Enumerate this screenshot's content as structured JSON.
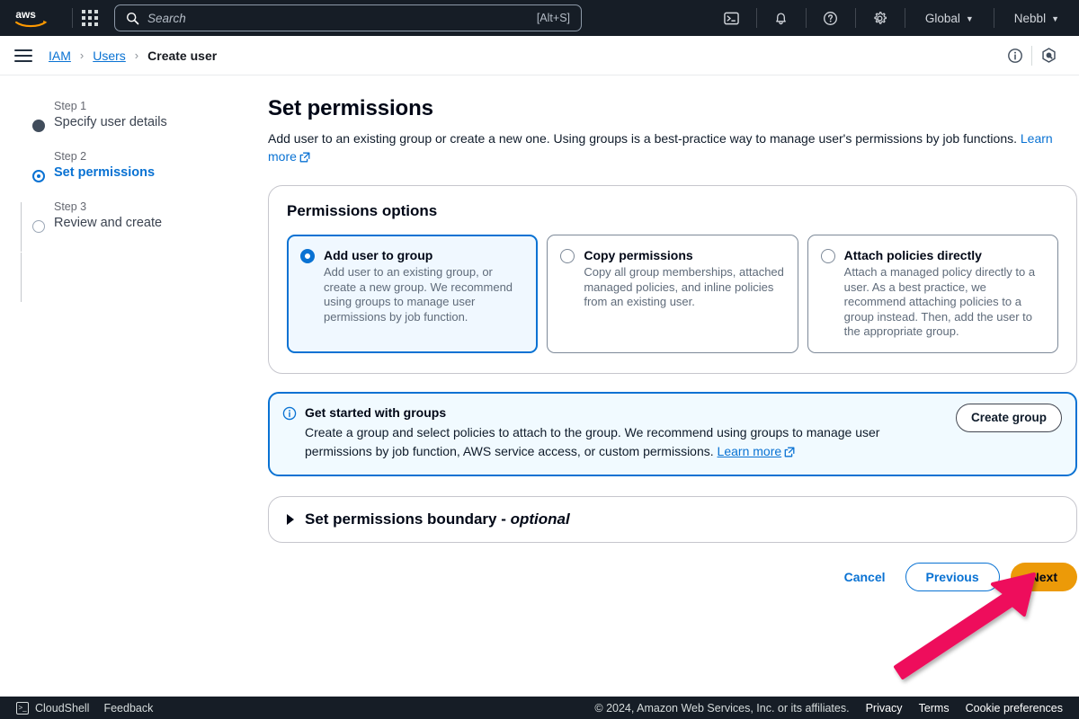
{
  "topnav": {
    "logo_alt": "aws",
    "apps_icon": "apps-grid-icon",
    "search": {
      "placeholder": "Search",
      "value": "",
      "shortcut": "[Alt+S]",
      "icon": "search-icon"
    },
    "cloudshell_icon": "cloudshell-icon",
    "notifications_icon": "bell-icon",
    "help_icon": "question-circle-icon",
    "settings_icon": "gear-icon",
    "region": "Global",
    "account": "Nebbl",
    "caret": "▼"
  },
  "breadcrumb": {
    "menu_icon": "hamburger-menu-icon",
    "items": [
      {
        "label": "IAM",
        "link": true
      },
      {
        "label": "Users",
        "link": true
      },
      {
        "label": "Create user",
        "link": false
      }
    ],
    "separator": "›",
    "info_icon": "info-circle-icon",
    "assistant_icon": "amazon-q-icon"
  },
  "stepper": {
    "steps": [
      {
        "num": "Step 1",
        "label": "Specify user details",
        "state": "done"
      },
      {
        "num": "Step 2",
        "label": "Set permissions",
        "state": "active"
      },
      {
        "num": "Step 3",
        "label": "Review and create",
        "state": "todo"
      }
    ]
  },
  "main": {
    "title": "Set permissions",
    "description": "Add user to an existing group or create a new one. Using groups is a best-practice way to manage user's permissions by job functions.",
    "description_link": "Learn more",
    "permissions_options": {
      "heading": "Permissions options",
      "tiles": [
        {
          "title": "Add user to group",
          "desc": "Add user to an existing group, or create a new group. We recommend using groups to manage user permissions by job function.",
          "selected": true
        },
        {
          "title": "Copy permissions",
          "desc": "Copy all group memberships, attached managed policies, and inline policies from an existing user.",
          "selected": false
        },
        {
          "title": "Attach policies directly",
          "desc": "Attach a managed policy directly to a user. As a best practice, we recommend attaching policies to a group instead. Then, add the user to the appropriate group.",
          "selected": false
        }
      ]
    },
    "alert": {
      "icon": "info-circle-icon",
      "title": "Get started with groups",
      "text": "Create a group and select policies to attach to the group. We recommend using groups to manage user permissions by job function, AWS service access, or custom permissions.",
      "link": "Learn more",
      "button": "Create group"
    },
    "expandable": {
      "icon": "triangle-right-icon",
      "title": "Set permissions boundary - ",
      "title_optional": "optional"
    },
    "actions": {
      "cancel": "Cancel",
      "previous": "Previous",
      "next": "Next"
    }
  },
  "annotation": {
    "arrow_color": "#ee0f5b",
    "points_at": "next-button"
  },
  "bottombar": {
    "cloudshell": "CloudShell",
    "feedback": "Feedback",
    "copyright": "© 2024, Amazon Web Services, Inc. or its affiliates.",
    "links": [
      "Privacy",
      "Terms",
      "Cookie preferences"
    ]
  },
  "colors": {
    "nav_bg": "#161d26",
    "accent_blue": "#0972d3",
    "next_orange": "#ec9a08",
    "annotation_pink": "#ee0f5b"
  }
}
